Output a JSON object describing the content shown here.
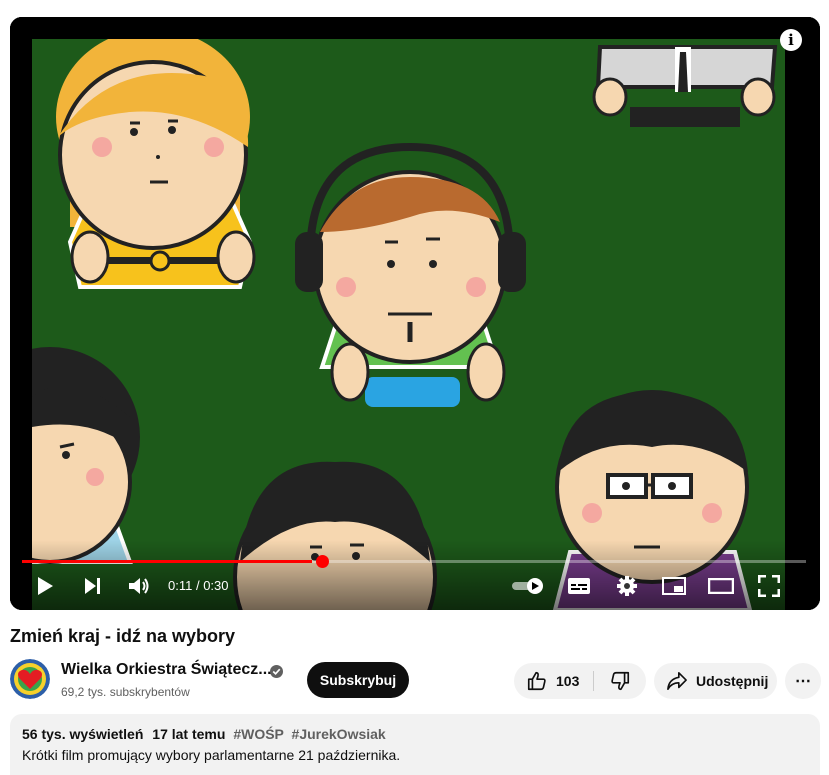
{
  "video": {
    "info_label": "i",
    "time_current": "0:11",
    "time_separator": " / ",
    "time_total": "0:30",
    "progress_fraction": 0.37
  },
  "title": "Zmień kraj - idź na wybory",
  "channel": {
    "name": "Wielka Orkiestra Świątecz...",
    "subscribers": "69,2 tys. subskrybentów",
    "subscribe_label": "Subskrybuj"
  },
  "actions": {
    "like_count": "103",
    "share_label": "Udostępnij",
    "more_label": "⋯"
  },
  "description": {
    "views": "56 tys. wyświetleń",
    "age": "17 lat temu",
    "tags": [
      "#WOŚP",
      "#JurekOwsiak"
    ],
    "text": "Krótki film promujący wybory parlamentarne 21 października."
  },
  "colors": {
    "accent": "#ff0000",
    "video_bg": "#1d5a1a"
  }
}
